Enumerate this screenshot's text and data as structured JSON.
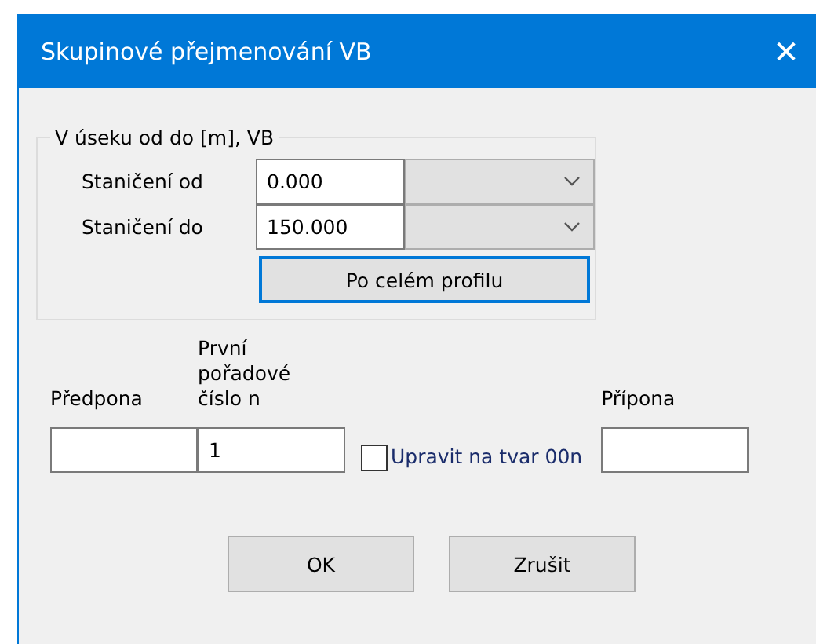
{
  "window": {
    "title": "Skupinové přejmenování VB",
    "close": "✕"
  },
  "range_group": {
    "legend": "V úseku od do [m], VB",
    "rows": [
      {
        "label": "Staničení od",
        "value": "0.000"
      },
      {
        "label": "Staničení do",
        "value": "150.000"
      }
    ],
    "button": {
      "label": "Po celém profilu",
      "focused": true
    }
  },
  "naming": {
    "prefix": {
      "label": "Předpona"
    },
    "first_number": {
      "label": "První pořadové číslo n",
      "value": "1"
    },
    "pad_checkbox": {
      "label": "Upravit na tvar 00n",
      "checked": false
    },
    "suffix": {
      "label": "Přípona"
    }
  },
  "buttons": [
    {
      "label": "OK"
    },
    {
      "label": "Zrušit"
    }
  ]
}
